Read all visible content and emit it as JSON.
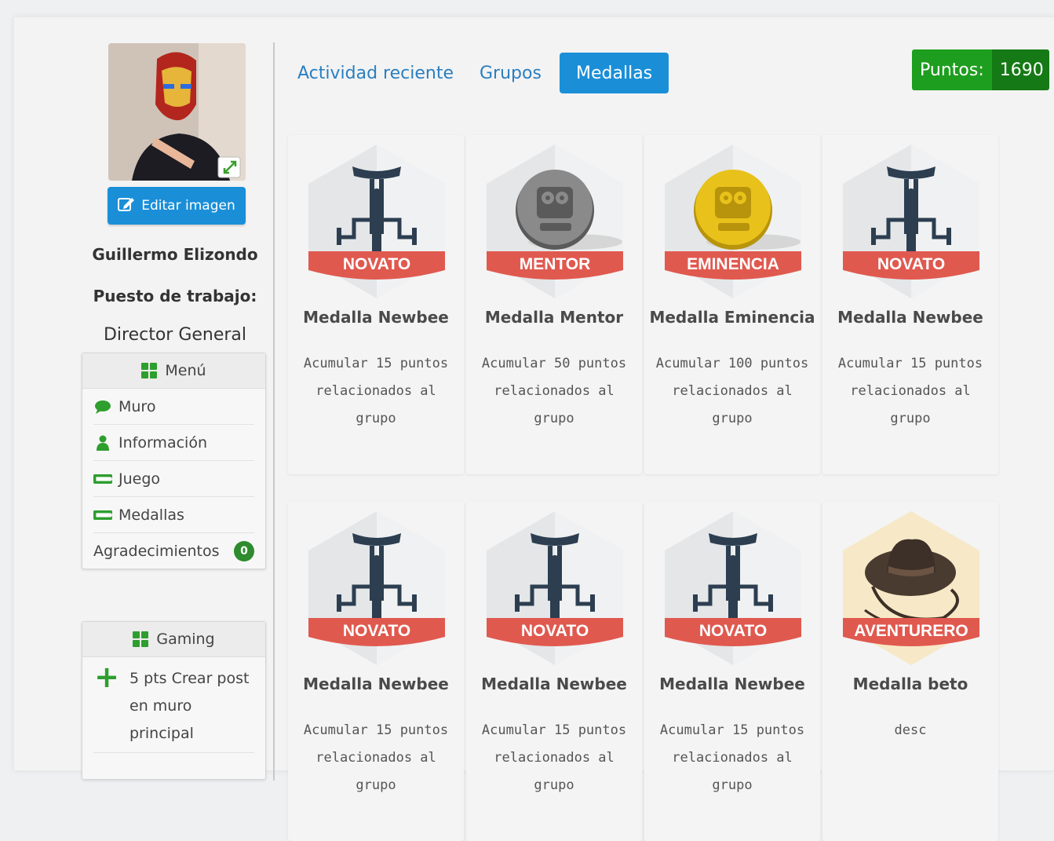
{
  "profile": {
    "edit_label": "Editar imagen",
    "name": "Guillermo Elizondo",
    "job_label": "Puesto de trabajo:",
    "job_value": "Director General"
  },
  "menu": {
    "title": "Menú",
    "items": [
      {
        "label": "Muro",
        "icon": "chat-bubble-icon"
      },
      {
        "label": "Información",
        "icon": "user-icon"
      },
      {
        "label": "Juego",
        "icon": "ticket-icon"
      },
      {
        "label": "Medallas",
        "icon": "ticket-icon"
      },
      {
        "label": "Agradecimientos",
        "badge": "0"
      }
    ]
  },
  "gaming": {
    "title": "Gaming",
    "items": [
      {
        "lines": [
          "5 pts Crear post",
          "en muro",
          "principal"
        ],
        "icon": "plus-icon"
      }
    ]
  },
  "tabs": [
    {
      "label": "Actividad reciente",
      "active": false
    },
    {
      "label": "Grupos",
      "active": false
    },
    {
      "label": "Medallas",
      "active": true
    }
  ],
  "points": {
    "label": "Puntos:",
    "value": "1690"
  },
  "medals": [
    {
      "title": "Medalla Newbee",
      "desc_lines": [
        "Acumular 15 puntos",
        "relacionados al grupo"
      ],
      "banner": "NOVATO",
      "icon": "tricycle-icon"
    },
    {
      "title": "Medalla Mentor",
      "desc_lines": [
        "Acumular 50 puntos",
        "relacionados al grupo"
      ],
      "banner": "MENTOR",
      "icon": "owl-coin-silver-icon"
    },
    {
      "title": "Medalla Eminencia",
      "desc_lines": [
        "Acumular 100 puntos",
        "relacionados al grupo"
      ],
      "banner": "EMINENCIA",
      "icon": "owl-coin-gold-icon"
    },
    {
      "title": "Medalla Newbee",
      "desc_lines": [
        "Acumular 15 puntos",
        "relacionados al grupo"
      ],
      "banner": "NOVATO",
      "icon": "tricycle-icon"
    },
    {
      "title": "Medalla Newbee",
      "desc_lines": [
        "Acumular 15 puntos",
        "relacionados al grupo"
      ],
      "banner": "NOVATO",
      "icon": "tricycle-icon"
    },
    {
      "title": "Medalla Newbee",
      "desc_lines": [
        "Acumular 15 puntos",
        "relacionados al grupo"
      ],
      "banner": "NOVATO",
      "icon": "tricycle-icon"
    },
    {
      "title": "Medalla Newbee",
      "desc_lines": [
        "Acumular 15 puntos",
        "relacionados al grupo"
      ],
      "banner": "NOVATO",
      "icon": "tricycle-icon"
    },
    {
      "title": "Medalla beto",
      "desc_lines": [
        "desc"
      ],
      "banner": "AVENTURERO",
      "icon": "cowboy-hat-icon"
    }
  ],
  "colors": {
    "primary": "#1a8fd8",
    "link": "#2a7fc0",
    "points_green": "#1e9e1e",
    "points_dark": "#157a15",
    "banner_red": "#e0594f",
    "hex_bg": "#e4e6e8",
    "navy": "#2c3e50",
    "gold": "#e8c21a",
    "silver": "#8a8a8a"
  }
}
